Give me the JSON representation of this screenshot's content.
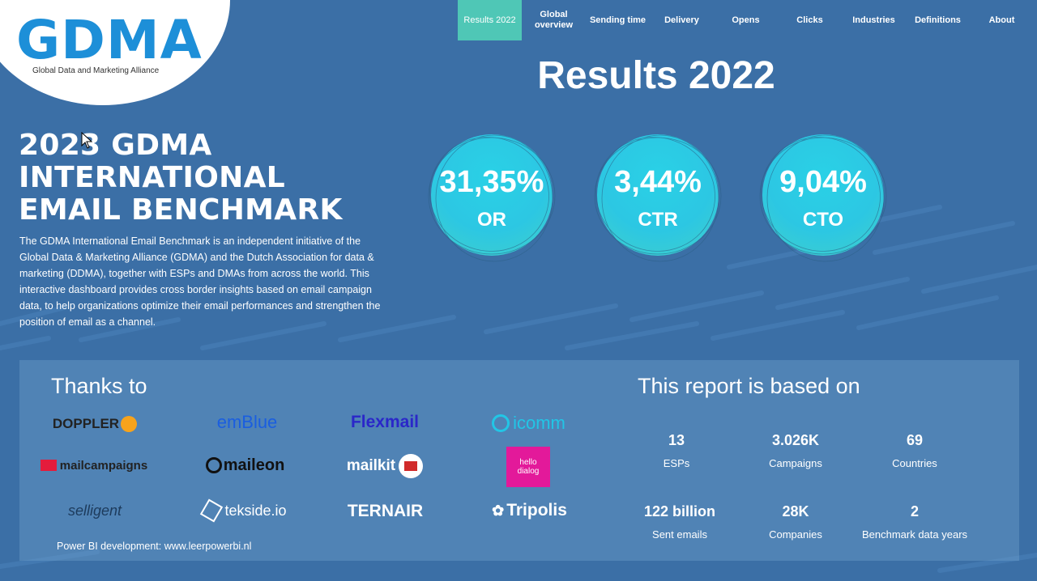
{
  "logo": {
    "text": "GDMA",
    "subtitle": "Global Data and Marketing Alliance"
  },
  "nav": [
    {
      "label": "Results 2022",
      "active": true
    },
    {
      "label": "Global overview",
      "active": false
    },
    {
      "label": "Sending time",
      "active": false
    },
    {
      "label": "Delivery",
      "active": false
    },
    {
      "label": "Opens",
      "active": false
    },
    {
      "label": "Clicks",
      "active": false
    },
    {
      "label": "Industries",
      "active": false
    },
    {
      "label": "Definitions",
      "active": false
    },
    {
      "label": "About",
      "active": false
    }
  ],
  "page_title": "Results 2022",
  "benchmark": {
    "title_line1": "2023 GDMA",
    "title_line2": "INTERNATIONAL",
    "title_line3": "EMAIL BENCHMARK",
    "description": "The GDMA International Email Benchmark is an independent initiative of the Global Data & Marketing Alliance (GDMA) and the Dutch Association for data & marketing (DDMA), together with ESPs and DMAs from across the world. This interactive dashboard provides cross border insights based on email campaign data, to help organizations optimize their email performances and strengthen the position of email as a channel."
  },
  "kpis": [
    {
      "value": "31,35%",
      "label": "OR"
    },
    {
      "value": "3,44%",
      "label": "CTR"
    },
    {
      "value": "9,04%",
      "label": "CTO"
    }
  ],
  "thanks": {
    "title": "Thanks to",
    "partners": [
      "DOPPLER",
      "emBlue",
      "Flexmail",
      "icomm",
      "mailcampaigns",
      "maileon",
      "mailkit",
      "hello dialog",
      "selligent",
      "tekside.io",
      "TERNAIR",
      "Tripolis"
    ],
    "powerbi": "Power BI development: www.leerpowerbi.nl"
  },
  "report": {
    "title": "This report is based on",
    "stats": [
      {
        "value": "13",
        "label": "ESPs"
      },
      {
        "value": "3.026K",
        "label": "Campaigns"
      },
      {
        "value": "69",
        "label": "Countries"
      },
      {
        "value": "122 billion",
        "label": "Sent emails"
      },
      {
        "value": "28K",
        "label": "Companies"
      },
      {
        "value": "2",
        "label": "Benchmark data years"
      }
    ]
  },
  "colors": {
    "background": "#3b6fa6",
    "accent": "#4fc7b6",
    "circle": "#2cc7e3",
    "logo": "#1d8fd8"
  }
}
